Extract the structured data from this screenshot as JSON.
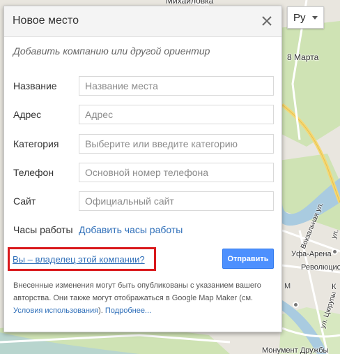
{
  "map": {
    "labels": {
      "mikhailovka": "Михайловка",
      "eighth_march": "8 Марта",
      "vokzalnaya": "Вокзальная ул.",
      "ufa_arena": "Уфа-Арена",
      "revolyutsionnaya": "Революционная",
      "tsyurupy": "ул. Цюрупы",
      "monument": "Монумент Дружбы",
      "letter_k": "К",
      "letter_m": "М",
      "ul_short": "ул."
    }
  },
  "language": {
    "label": "Ру"
  },
  "dialog": {
    "title": "Новое место",
    "subtitle": "Добавить компанию или другой ориентир",
    "fields": {
      "name": {
        "label": "Название",
        "placeholder": "Название места",
        "value": ""
      },
      "address": {
        "label": "Адрес",
        "placeholder": "Адрес",
        "value": ""
      },
      "category": {
        "label": "Категория",
        "placeholder": "Выберите или введите категорию",
        "value": ""
      },
      "phone": {
        "label": "Телефон",
        "placeholder": "Основной номер телефона",
        "value": ""
      },
      "site": {
        "label": "Сайт",
        "placeholder": "Официальный сайт",
        "value": ""
      }
    },
    "hours": {
      "label": "Часы работы",
      "link": "Добавить часы работы"
    },
    "owner_link": "Вы – владелец этой компании?",
    "submit": "Отправить",
    "notice": {
      "text1": "Внесенные изменения могут быть опубликованы с указанием вашего авторства. Они также могут отображаться в Google Map Maker (см.",
      "terms_link": "Условия использования",
      "text2": ").",
      "more_link": "Подробнее..."
    }
  },
  "colors": {
    "link": "#2f6fb9",
    "submit_bg": "#4d90fe",
    "highlight": "#d9191c",
    "river": "#a9cbe0",
    "park": "#cfe3b4",
    "road_major": "#f6d872"
  }
}
